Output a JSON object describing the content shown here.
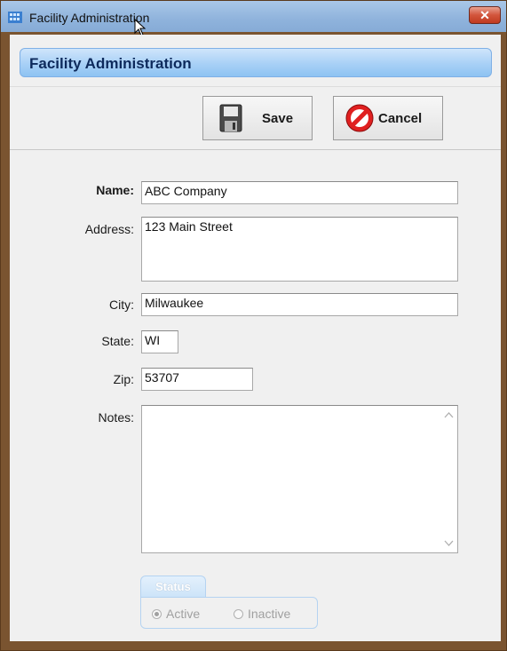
{
  "window": {
    "title": "Facility Administration",
    "close_label": "✕"
  },
  "header": {
    "title": "Facility Administration"
  },
  "toolbar": {
    "save_label": "Save",
    "cancel_label": "Cancel"
  },
  "form": {
    "name_label": "Name:",
    "name_value": "ABC Company",
    "address_label": "Address:",
    "address_value": "123 Main Street",
    "city_label": "City:",
    "city_value": "Milwaukee",
    "state_label": "State:",
    "state_value": "WI",
    "zip_label": "Zip:",
    "zip_value": "53707",
    "notes_label": "Notes:",
    "notes_value": ""
  },
  "status": {
    "group_label": "Status",
    "active_label": "Active",
    "inactive_label": "Inactive",
    "selected": "Active"
  },
  "colors": {
    "accent": "#8ec3f2",
    "header_text": "#0d2a5c",
    "window_frame": "#7a5430"
  },
  "icons": {
    "title": "app-grid-icon",
    "save": "floppy-disk-icon",
    "cancel": "no-entry-icon",
    "close": "close-icon"
  }
}
